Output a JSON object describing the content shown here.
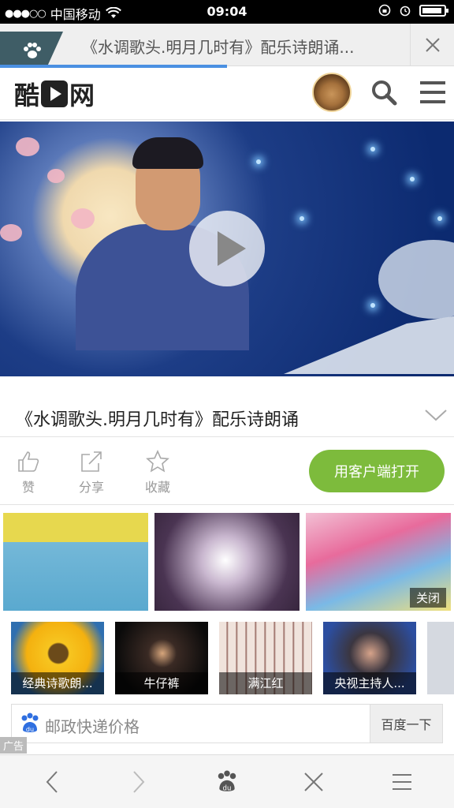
{
  "status_bar": {
    "signal": "●●●○○",
    "carrier": "中国移动",
    "time": "09:04"
  },
  "browser_tab": {
    "title": "《水调歌头.明月几时有》配乐诗朗诵..."
  },
  "site": {
    "logo_text_left": "酷",
    "logo_text_right": "网"
  },
  "video": {
    "title": "《水调歌头.明月几时有》配乐诗朗诵"
  },
  "actions": {
    "like_label": "赞",
    "share_label": "分享",
    "favorite_label": "收藏",
    "open_app_label": "用客户端打开"
  },
  "ad": {
    "close_label": "关闭",
    "ad_label": "广告"
  },
  "related": [
    {
      "caption": "经典诗歌朗..."
    },
    {
      "caption": "牛仔裤"
    },
    {
      "caption": "满江红"
    },
    {
      "caption": "央视主持人..."
    }
  ],
  "search": {
    "placeholder": "邮政快递价格",
    "button_label": "百度一下"
  },
  "colors": {
    "accent_green": "#7dbb3c",
    "progress_blue": "#4a90e2"
  },
  "icons": [
    "wifi-icon",
    "lock-rotation-icon",
    "alarm-icon",
    "battery-icon",
    "paw-icon",
    "close-icon",
    "search-icon",
    "menu-icon",
    "play-icon",
    "chevron-down-icon",
    "thumbs-up-icon",
    "share-icon",
    "star-icon",
    "back-icon",
    "forward-icon",
    "baidu-paw-icon",
    "close-tab-icon",
    "menu-lines-icon"
  ],
  "page_load_progress": 0.5
}
